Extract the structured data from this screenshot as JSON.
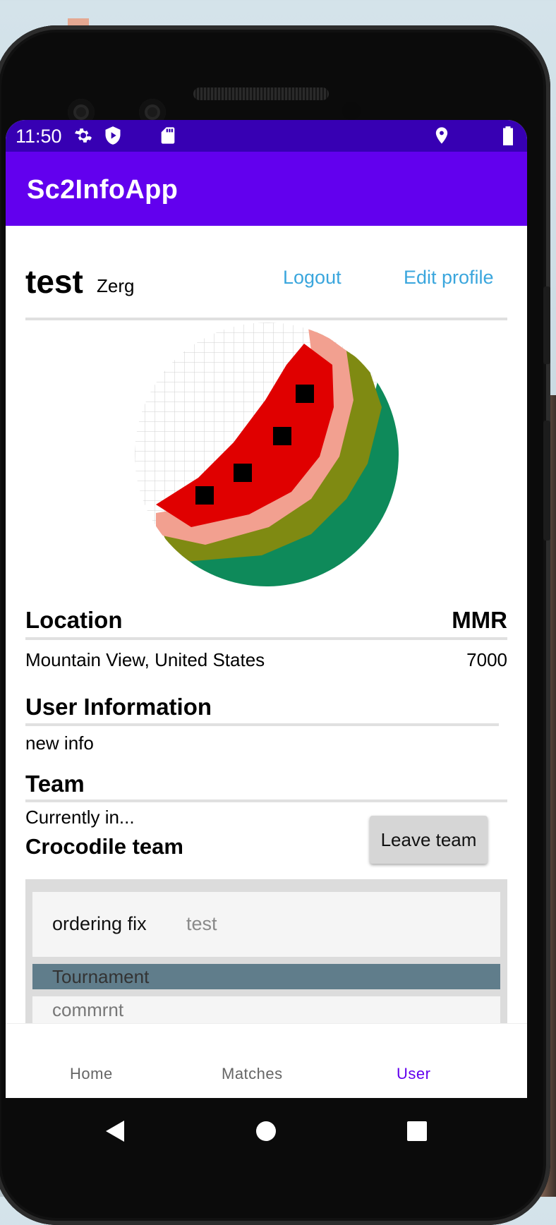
{
  "status_bar": {
    "time": "11:50"
  },
  "app_bar": {
    "title": "Sc2InfoApp"
  },
  "profile": {
    "username": "test",
    "race": "Zerg",
    "logout_label": "Logout",
    "edit_profile_label": "Edit profile"
  },
  "location": {
    "header": "Location",
    "value": "Mountain View, United States"
  },
  "mmr": {
    "header": "MMR",
    "value": "7000"
  },
  "user_info": {
    "header": "User Information",
    "value": "new info"
  },
  "team": {
    "header": "Team",
    "currently_in": "Currently in...",
    "name": "Crocodile team",
    "leave_label": "Leave team"
  },
  "team_matches": {
    "title": "ordering fix",
    "subtitle": "test",
    "section": "Tournament",
    "comment": "commrnt"
  },
  "bottom_nav": {
    "items": [
      {
        "label": "Home",
        "active": false
      },
      {
        "label": "Matches",
        "active": false
      },
      {
        "label": "User",
        "active": true
      }
    ]
  },
  "colors": {
    "status_bar": "#3700b3",
    "app_bar": "#6200ee",
    "link": "#3aa6dd",
    "active_nav": "#6200ee",
    "inactive_nav": "#666666",
    "tournament_bar": "#607d8b"
  }
}
